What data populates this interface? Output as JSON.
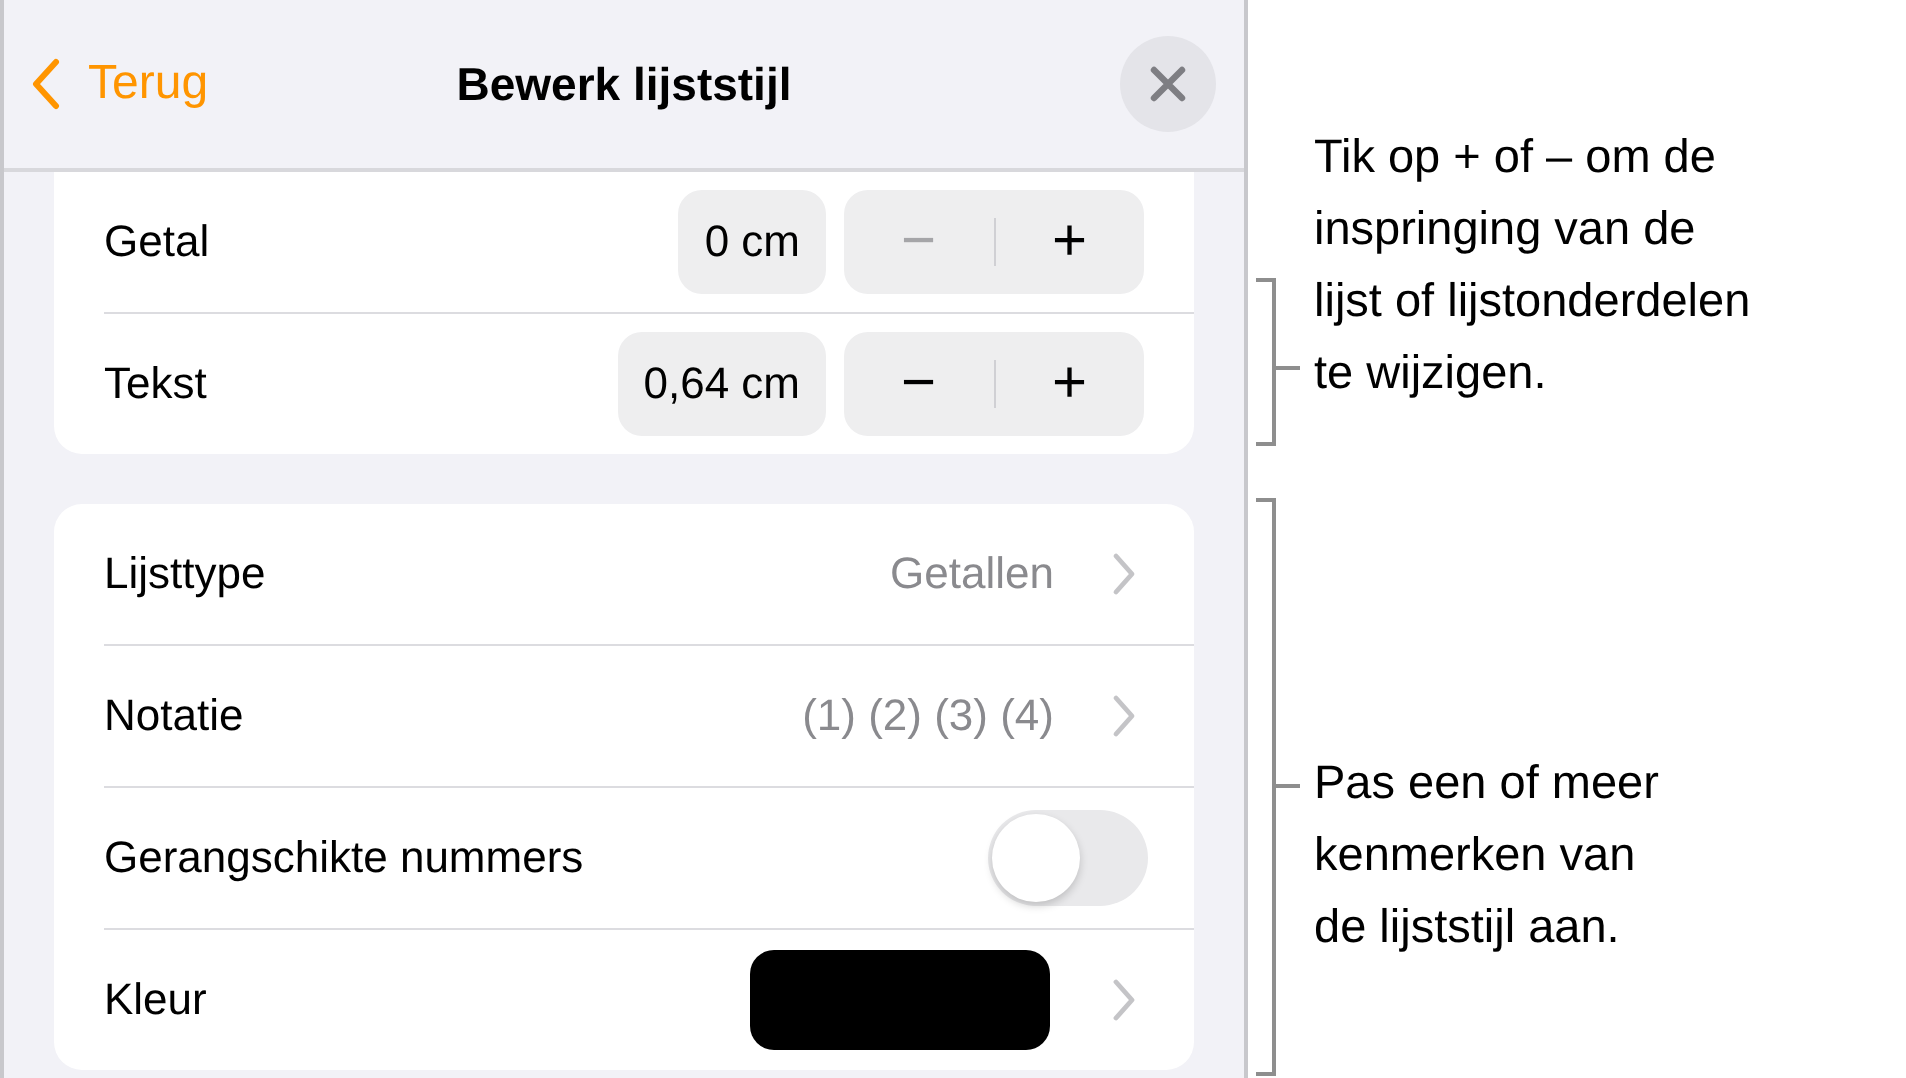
{
  "header": {
    "back_label": "Terug",
    "title": "Bewerk lijststijl"
  },
  "indents": [
    {
      "label": "Getal",
      "value": "0 cm",
      "minus": "−",
      "plus": "+",
      "minus_disabled": true
    },
    {
      "label": "Tekst",
      "value": "0,64 cm",
      "minus": "−",
      "plus": "+",
      "minus_disabled": false
    }
  ],
  "settings": [
    {
      "kind": "value",
      "label": "Lijsttype",
      "value": "Getallen"
    },
    {
      "kind": "value",
      "label": "Notatie",
      "value": "(1) (2) (3) (4)"
    },
    {
      "kind": "toggle",
      "label": "Gerangschikte nummers",
      "on": false
    },
    {
      "kind": "color",
      "label": "Kleur",
      "color": "#000000"
    }
  ],
  "callouts": [
    {
      "lines": [
        "Tik op + of – om de",
        "inspringing van de",
        "lijst of lijstonderdelen",
        "te wijzigen."
      ]
    },
    {
      "lines": [
        "Pas een of meer",
        "kenmerken van",
        "de lijststijl aan."
      ]
    }
  ]
}
